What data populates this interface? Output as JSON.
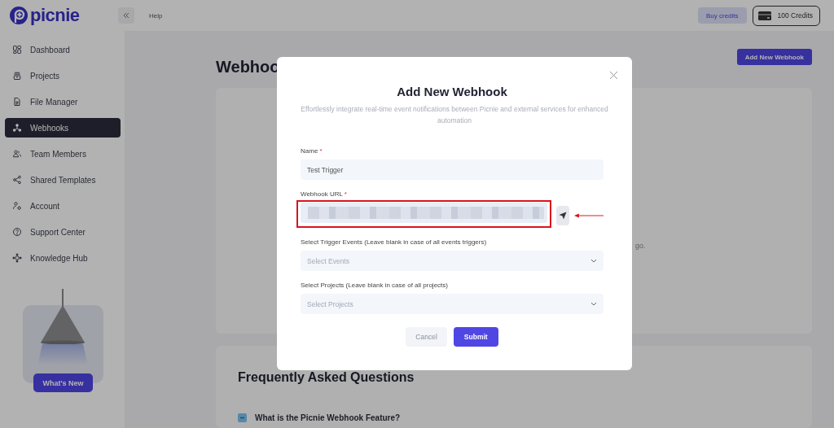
{
  "brand": {
    "name": "picnie"
  },
  "sidebar": {
    "items": [
      {
        "label": "Dashboard",
        "kind": "dashboard",
        "selected": false
      },
      {
        "label": "Projects",
        "kind": "projects",
        "selected": false
      },
      {
        "label": "File Manager",
        "kind": "file",
        "selected": false
      },
      {
        "label": "Webhooks",
        "kind": "webhook",
        "selected": true
      },
      {
        "label": "Team Members",
        "kind": "team",
        "selected": false
      },
      {
        "label": "Shared Templates",
        "kind": "share",
        "selected": false
      },
      {
        "label": "Account",
        "kind": "account",
        "selected": false
      },
      {
        "label": "Support Center",
        "kind": "help",
        "selected": false
      },
      {
        "label": "Knowledge Hub",
        "kind": "hub",
        "selected": false
      }
    ],
    "promo": {
      "button": "What's New"
    }
  },
  "topbar": {
    "link": "Help",
    "buy_button": "Buy credits",
    "credits": "100 Credits"
  },
  "page": {
    "title": "Webhoo",
    "add_button": "Add New Webhook",
    "card_text": "go.",
    "faq": {
      "title": "Frequently Asked Questions",
      "items": [
        {
          "question": "What is the Picnie Webhook Feature?",
          "expanded": true
        }
      ]
    }
  },
  "modal": {
    "title": "Add New Webhook",
    "subtitle": "Effortlessly integrate real-time event notifications between Picnie and external services for enhanced automation",
    "fields": [
      {
        "kind": "text",
        "label": "Name",
        "required_mark": "*",
        "value": "Test Trigger"
      },
      {
        "kind": "url",
        "label": "Webhook URL",
        "required_mark": "*",
        "redacted": true,
        "highlighted": true
      },
      {
        "kind": "select",
        "label": "Select Trigger Events (Leave blank in case of all events triggers)",
        "placeholder": "Select Events"
      },
      {
        "kind": "select",
        "label": "Select Projects (Leave blank in case of all projects)",
        "placeholder": "Select Projects"
      }
    ],
    "buttons": [
      {
        "label": "Cancel",
        "kind": "secondary"
      },
      {
        "label": "Submit",
        "kind": "primary"
      }
    ]
  }
}
